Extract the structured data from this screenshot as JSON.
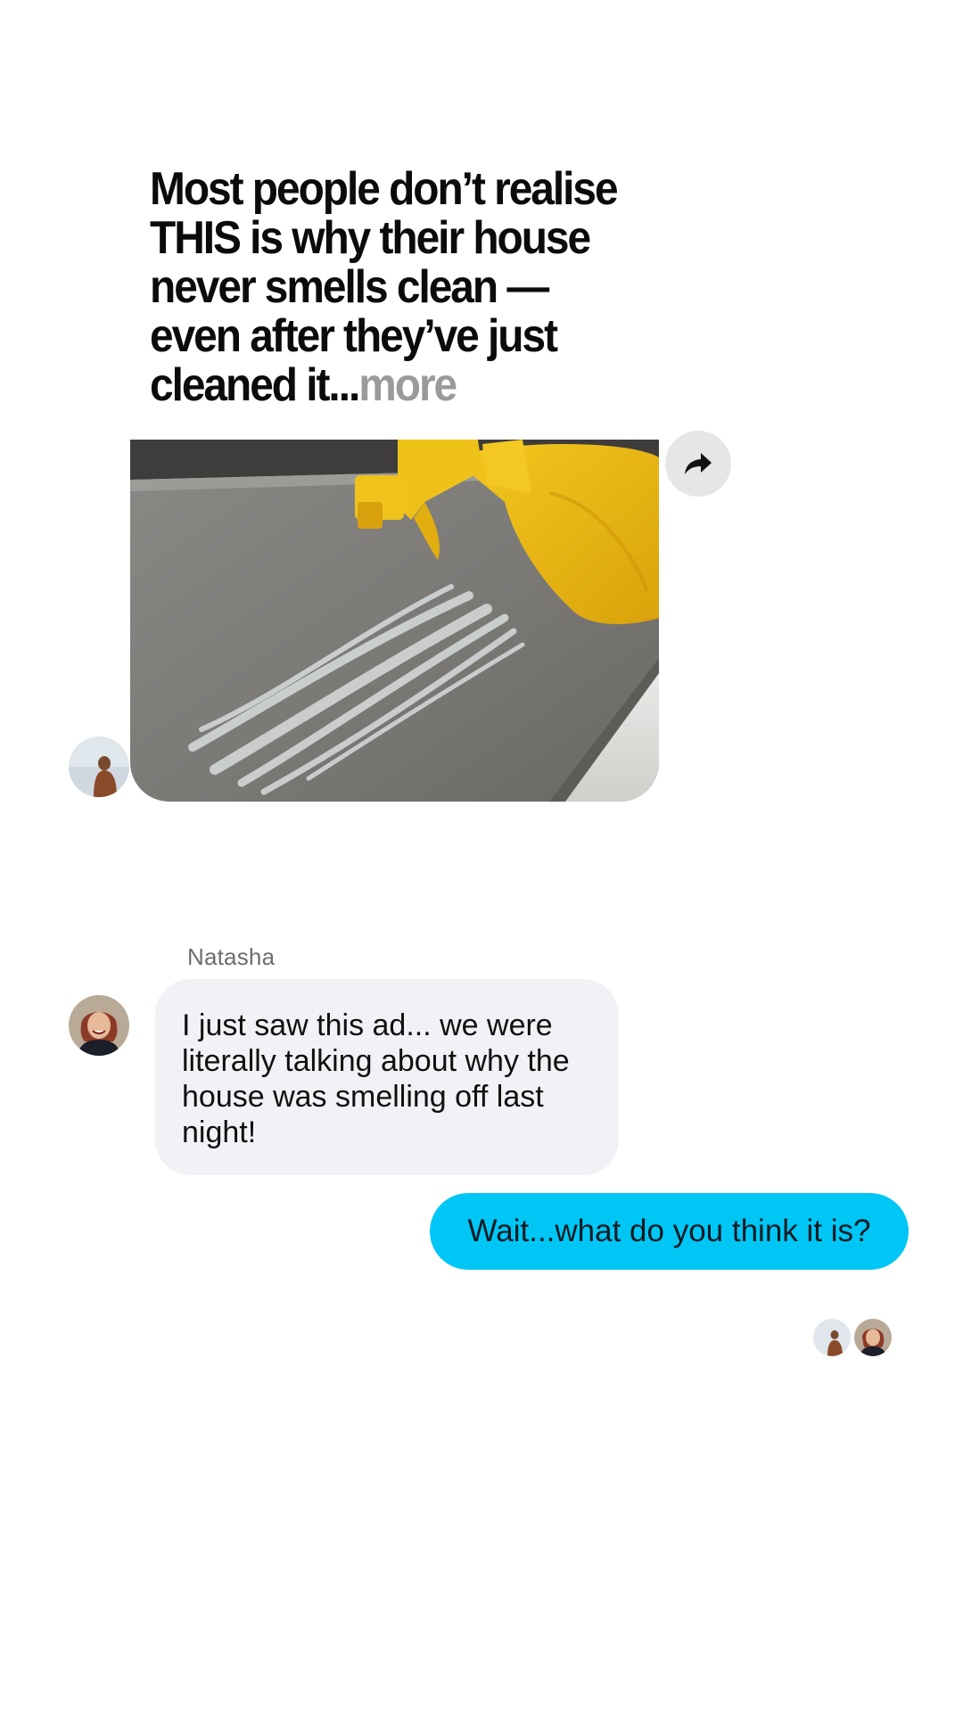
{
  "shared_post": {
    "headline": "Most people don’t realise THIS is why their house never smells clean — even after they’ve just cleaned it...",
    "more_link": "more",
    "share_icon": "share-forward-icon",
    "image_subject": "yellow spray bottle on grey countertop"
  },
  "messages": [
    {
      "sender": "Natasha",
      "text": "I just saw this ad... we were literally talking about why the house was smelling off last night!",
      "direction": "incoming"
    },
    {
      "text": "Wait...what do you think it is?",
      "direction": "outgoing"
    }
  ],
  "colors": {
    "outgoing_bubble": "#00c6f5",
    "incoming_bubble": "#f1f2f6",
    "share_button": "#e6e6e9",
    "more_text": "#9a9a9a"
  }
}
